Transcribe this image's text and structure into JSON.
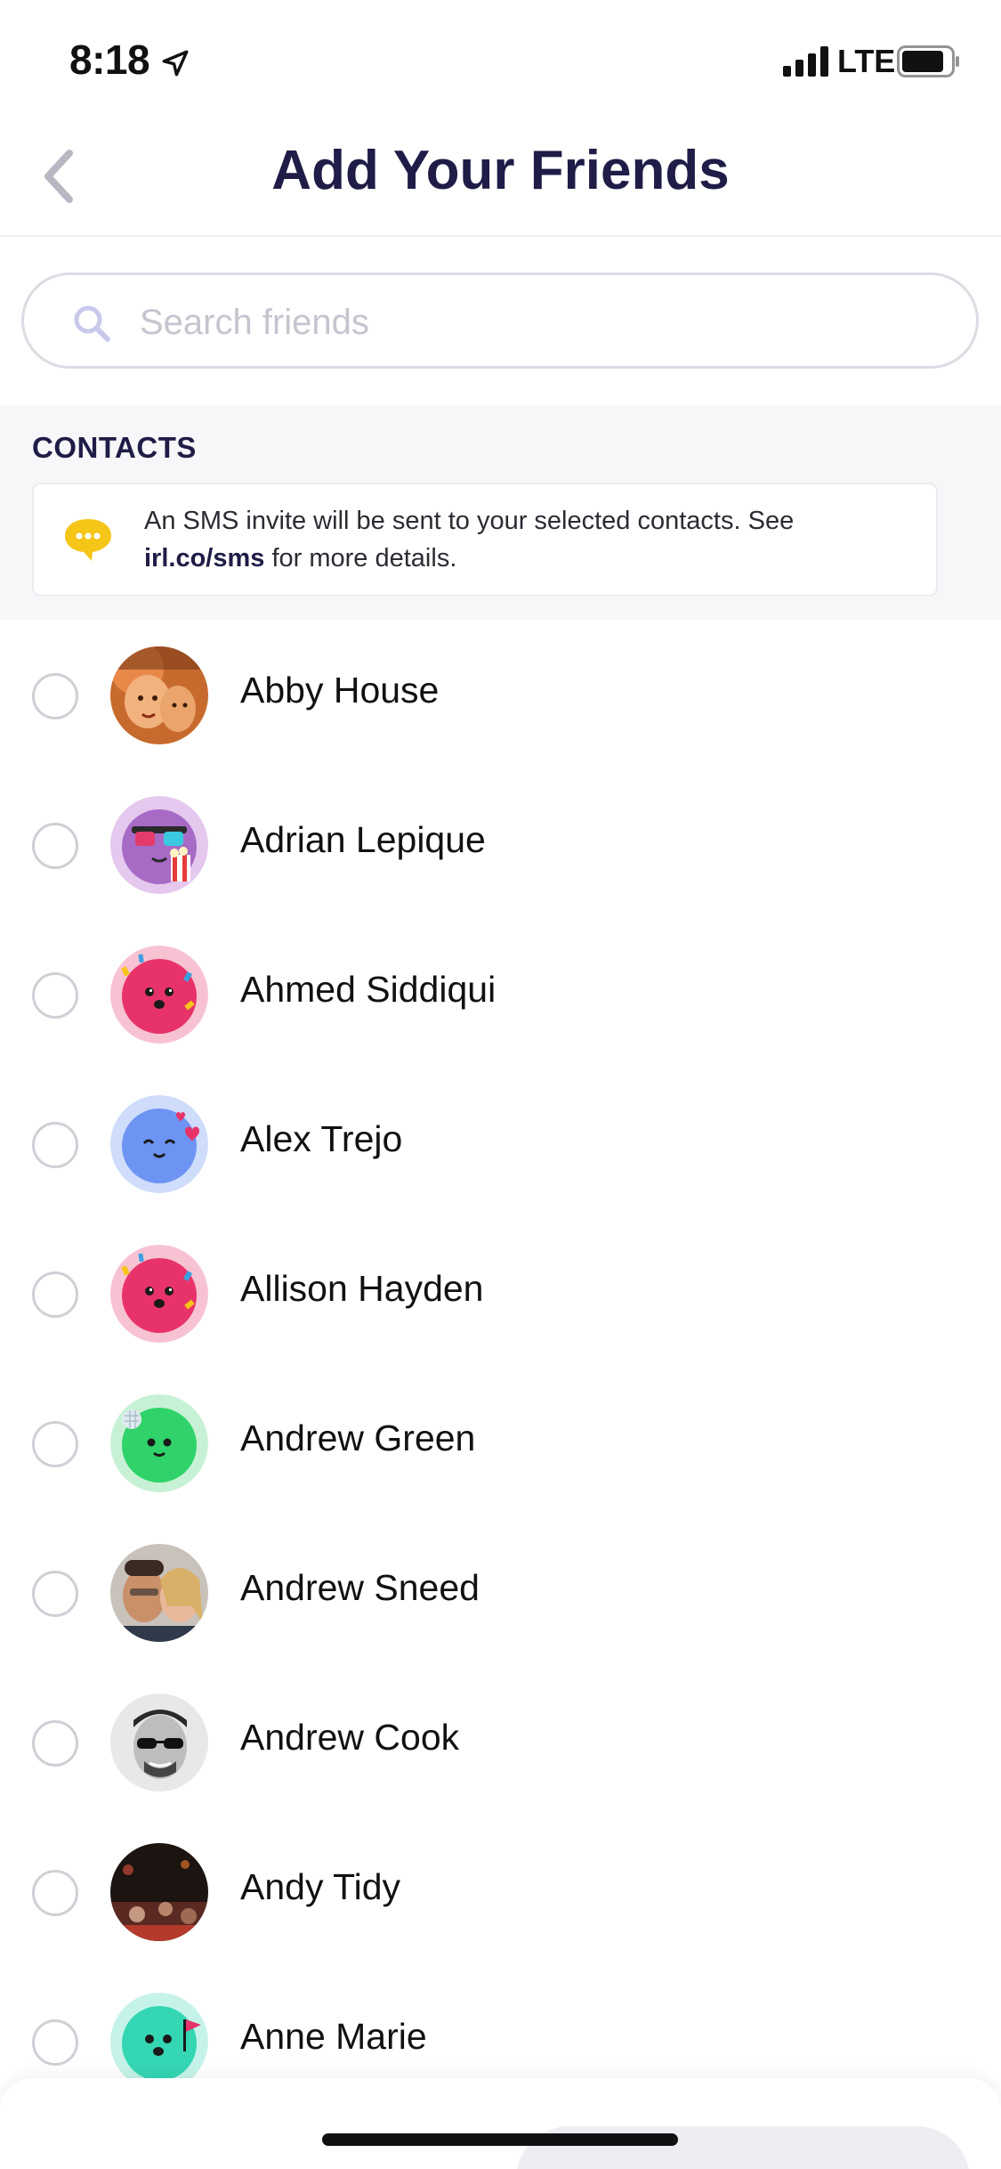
{
  "status_bar": {
    "time": "8:18",
    "network": "LTE"
  },
  "header": {
    "title": "Add Your Friends",
    "back_icon": "chevron-left-icon"
  },
  "search": {
    "placeholder": "Search friends",
    "value": ""
  },
  "contacts_section": {
    "title": "CONTACTS",
    "info_text_before": "An SMS invite will be sent to your selected contacts. See ",
    "info_link": "irl.co/sms",
    "info_text_after": " for more details.",
    "info_icon": "chat-bubble-icon"
  },
  "contacts": [
    {
      "name": "Abby House",
      "avatar": "photo",
      "selected": false
    },
    {
      "name": "Adrian Lepique",
      "avatar": "purple-emoji-popcorn",
      "selected": false
    },
    {
      "name": "Ahmed Siddiqui",
      "avatar": "pink-emoji-party",
      "selected": false
    },
    {
      "name": "Alex Trejo",
      "avatar": "blue-emoji-hearts",
      "selected": false
    },
    {
      "name": "Allison Hayden",
      "avatar": "pink-emoji-party",
      "selected": false
    },
    {
      "name": "Andrew Green",
      "avatar": "green-emoji-discoball",
      "selected": false
    },
    {
      "name": "Andrew Sneed",
      "avatar": "photo",
      "selected": false
    },
    {
      "name": "Andrew Cook",
      "avatar": "photo",
      "selected": false
    },
    {
      "name": "Andy Tidy",
      "avatar": "photo",
      "selected": false
    },
    {
      "name": "Anne Marie",
      "avatar": "teal-emoji-flag",
      "selected": false
    }
  ],
  "colors": {
    "title": "#1f1d47",
    "accent_yellow": "#f5c518",
    "radio_border": "#cfcfd6"
  }
}
